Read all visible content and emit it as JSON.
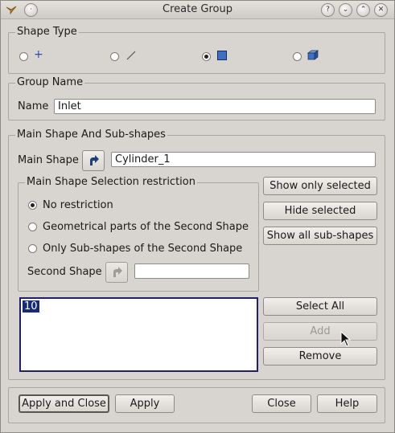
{
  "window": {
    "title": "Create Group"
  },
  "titlebar_buttons": {
    "help": "?",
    "minimize": "⌄",
    "maximize": "⌃",
    "close": "✕"
  },
  "shape_type": {
    "legend": "Shape Type",
    "options": [
      {
        "icon": "point-icon",
        "glyph": "+",
        "selected": false
      },
      {
        "icon": "edge-icon",
        "glyph": "⟋",
        "selected": false
      },
      {
        "icon": "face-icon",
        "glyph": "",
        "selected": true
      },
      {
        "icon": "solid-icon",
        "glyph": "",
        "selected": false
      }
    ]
  },
  "group_name": {
    "legend": "Group Name",
    "label": "Name",
    "value": "Inlet"
  },
  "main_shape_section": {
    "legend": "Main Shape And Sub-shapes",
    "main_shape_label": "Main Shape",
    "main_shape_value": "Cylinder_1",
    "restriction": {
      "legend": "Main Shape Selection restriction",
      "options": [
        {
          "label": "No restriction",
          "selected": true
        },
        {
          "label": "Geometrical parts of the Second Shape",
          "selected": false
        },
        {
          "label": "Only Sub-shapes of the Second Shape",
          "selected": false
        }
      ],
      "second_shape_label": "Second Shape",
      "second_shape_value": ""
    },
    "buttons": {
      "show_only_selected": "Show only selected",
      "hide_selected": "Hide selected",
      "show_all_subshapes": "Show all sub-shapes",
      "select_all": "Select All",
      "add": "Add",
      "remove": "Remove"
    },
    "ids_list": [
      "10"
    ]
  },
  "footer": {
    "apply_and_close": "Apply and Close",
    "apply": "Apply",
    "close": "Close",
    "help": "Help"
  }
}
